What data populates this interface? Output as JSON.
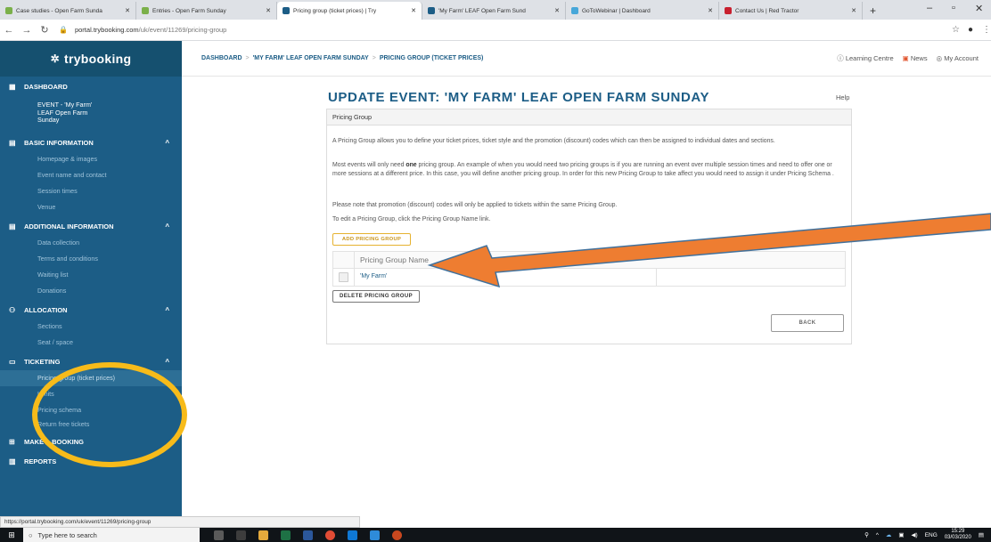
{
  "browser": {
    "tabs": [
      {
        "title": "Case studies - Open Farm Sunda",
        "active": false
      },
      {
        "title": "Entries - Open Farm Sunday",
        "active": false
      },
      {
        "title": "Pricing group (ticket prices) | Try",
        "active": true
      },
      {
        "title": "'My Farm' LEAF Open Farm Sund",
        "active": false
      },
      {
        "title": "GoToWebinar | Dashboard",
        "active": false
      },
      {
        "title": "Contact Us | Red Tractor",
        "active": false
      }
    ],
    "new_tab": "+",
    "window_controls": {
      "minimize": "–",
      "maximize": "▫",
      "close": "✕"
    },
    "url_host": "portal.trybooking.com",
    "url_path": "/uk/event/11269/pricing-group",
    "status_url": "https://portal.trybooking.com/uk/event/11269/pricing-group"
  },
  "sidebar": {
    "logo": "trybooking",
    "dashboard": "DASHBOARD",
    "event_block": [
      "EVENT - 'My Farm'",
      "LEAF Open Farm",
      "Sunday"
    ],
    "sections": [
      {
        "title": "BASIC INFORMATION",
        "items": [
          "Homepage & images",
          "Event name and contact",
          "Session times",
          "Venue"
        ]
      },
      {
        "title": "ADDITIONAL INFORMATION",
        "items": [
          "Data collection",
          "Terms and conditions",
          "Waiting list",
          "Donations"
        ]
      },
      {
        "title": "ALLOCATION",
        "items": [
          "Sections",
          "Seat / space"
        ]
      },
      {
        "title": "TICKETING",
        "items": [
          "Pricing group (ticket prices)",
          "Limits",
          "Pricing schema",
          "Return free tickets"
        ]
      }
    ],
    "make_booking": "MAKE A BOOKING",
    "reports": "REPORTS"
  },
  "breadcrumb": {
    "items": [
      "DASHBOARD",
      "'MY FARM' LEAF OPEN FARM SUNDAY",
      "PRICING GROUP (TICKET PRICES)"
    ],
    "separator": ">"
  },
  "topnav": {
    "learning_centre": "Learning Centre",
    "news": "News",
    "my_account": "My Account"
  },
  "main": {
    "title": "UPDATE EVENT: 'MY FARM' LEAF OPEN FARM SUNDAY",
    "help": "Help",
    "panel_title": "Pricing Group",
    "para1": "A Pricing Group allows you to define your ticket prices, ticket style and the promotion (discount) codes which can then be assigned to individual dates and sections.",
    "para2_before": "Most events will only need ",
    "para2_bold": "one",
    "para2_after": " pricing group. An example of when you would need two pricing groups is if you are running an event over multiple session times and need to offer one or more sessions at a different price. In this case, you will define another pricing group. In order for this new Pricing Group to take affect you would need to assign it under Pricing Schema .",
    "para3": "Please note that promotion (discount) codes will only be applied to tickets within the same Pricing Group.",
    "para4": "To edit a Pricing Group, click the Pricing Group Name link.",
    "add_button": "ADD PRICING GROUP",
    "table_header": "Pricing Group Name",
    "table_rows": [
      "'My Farm'"
    ],
    "delete_button": "DELETE PRICING GROUP",
    "back_button": "BACK"
  },
  "taskbar": {
    "search_placeholder": "Type here to search",
    "language": "ENG",
    "time": "15:29",
    "date": "03/03/2020"
  },
  "colors": {
    "sidebar": "#1c5d86",
    "brand_text": "#1c5d86",
    "accent_button": "#e6b230",
    "annotation_arrow": "#ee7d31",
    "annotation_ellipse": "#f7bb1a"
  }
}
